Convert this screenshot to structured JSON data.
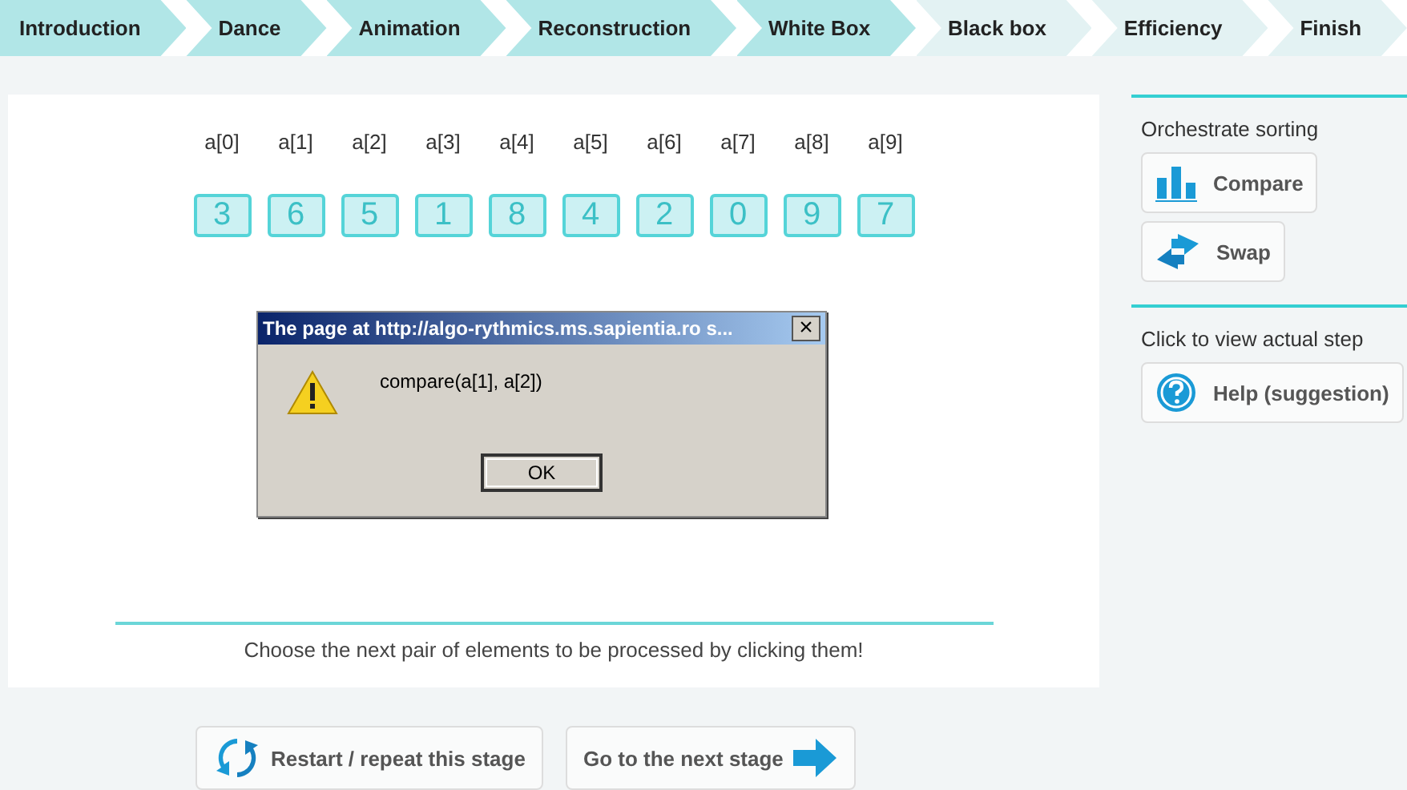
{
  "stages": [
    {
      "label": "Introduction",
      "completed": true
    },
    {
      "label": "Dance",
      "completed": true
    },
    {
      "label": "Animation",
      "completed": true
    },
    {
      "label": "Reconstruction",
      "completed": true
    },
    {
      "label": "White Box",
      "completed": true
    },
    {
      "label": "Black box",
      "completed": false
    },
    {
      "label": "Efficiency",
      "completed": false
    },
    {
      "label": "Finish",
      "completed": false
    }
  ],
  "array": [
    {
      "index": "a[0]",
      "value": "3"
    },
    {
      "index": "a[1]",
      "value": "6"
    },
    {
      "index": "a[2]",
      "value": "5"
    },
    {
      "index": "a[3]",
      "value": "1"
    },
    {
      "index": "a[4]",
      "value": "8"
    },
    {
      "index": "a[5]",
      "value": "4"
    },
    {
      "index": "a[6]",
      "value": "2"
    },
    {
      "index": "a[7]",
      "value": "0"
    },
    {
      "index": "a[8]",
      "value": "9"
    },
    {
      "index": "a[9]",
      "value": "7"
    }
  ],
  "instruction": "Choose the next pair of elements to be processed by clicking them!",
  "dialog": {
    "title": "The page at http://algo-rythmics.ms.sapientia.ro s...",
    "close": "×",
    "message": "compare(a[1], a[2])",
    "button": "OK"
  },
  "sidebar": [
    {
      "heading": "Orchestrate sorting",
      "buttons": [
        {
          "kind": "compare",
          "label": "Compare"
        },
        {
          "kind": "swap",
          "label": "Swap"
        }
      ]
    },
    {
      "heading": "Click to view actual step",
      "buttons": [
        {
          "kind": "help",
          "label": "Help (suggestion)"
        }
      ]
    }
  ],
  "footer_buttons": [
    {
      "kind": "restart",
      "label": "Restart / repeat this stage"
    },
    {
      "kind": "next",
      "label": "Go to the next stage"
    }
  ]
}
